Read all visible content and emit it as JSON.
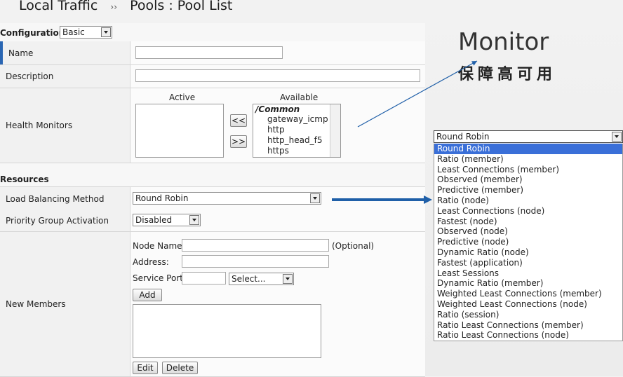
{
  "breadcrumb": {
    "part1": "Local Traffic",
    "separator": "››",
    "part2": "Pools : Pool List"
  },
  "configuration": {
    "label": "Configuration:",
    "value": "Basic"
  },
  "fields": {
    "name": "Name",
    "description": "Description",
    "health_monitors": "Health Monitors",
    "active_label": "Active",
    "available_label": "Available",
    "move_left": "<<",
    "move_right": ">>",
    "available_group": "/Common",
    "available_items": [
      "gateway_icmp",
      "http",
      "http_head_f5",
      "https"
    ]
  },
  "resources": {
    "header": "Resources",
    "load_balancing_label": "Load Balancing Method",
    "load_balancing_value": "Round Robin",
    "priority_label": "Priority Group Activation",
    "priority_value": "Disabled",
    "new_members_label": "New Members",
    "node_name_label": "Node Name:",
    "optional": "(Optional)",
    "address_label": "Address:",
    "service_port_label": "Service Port:",
    "port_select": "Select...",
    "add": "Add",
    "edit": "Edit",
    "delete": "Delete"
  },
  "dropdown": {
    "selected": "Round Robin",
    "options": [
      "Round Robin",
      "Ratio (member)",
      "Least Connections (member)",
      "Observed (member)",
      "Predictive (member)",
      "Ratio (node)",
      "Least Connections (node)",
      "Fastest (node)",
      "Observed (node)",
      "Predictive (node)",
      "Dynamic Ratio (node)",
      "Fastest (application)",
      "Least Sessions",
      "Dynamic Ratio (member)",
      "Weighted Least Connections (member)",
      "Weighted Least Connections (node)",
      "Ratio (session)",
      "Ratio Least Connections (member)",
      "Ratio Least Connections (node)"
    ]
  },
  "annotation": {
    "title": "Monitor",
    "subtitle": "保障高可用"
  },
  "colors": {
    "accent": "#2a66b3",
    "arrow": "#1f5fa8",
    "highlight": "#3a6fd8"
  }
}
